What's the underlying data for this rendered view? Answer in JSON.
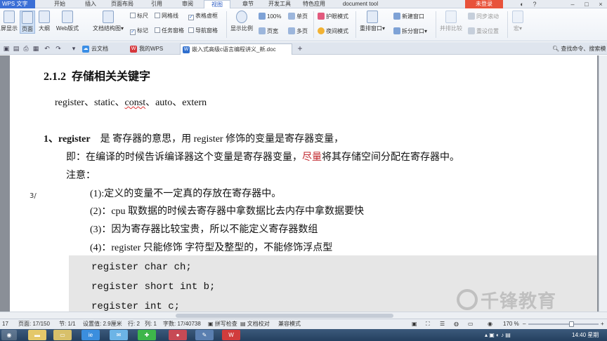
{
  "menubar": {
    "app": "WPS 文字",
    "items": [
      "开始",
      "插入",
      "页面布局",
      "引用",
      "审阅",
      "视图",
      "章节",
      "开发工具",
      "特色应用",
      "document tool"
    ],
    "active_index": 5,
    "login": "未登录"
  },
  "ribbon": {
    "view_buttons": [
      "屏显示",
      "页面",
      "大纲",
      "Web版式"
    ],
    "doc_structure": "文档结构图",
    "labels": "标记",
    "ruler": "标尺",
    "gridlines": "网格线",
    "table_gridlines": "表格虚框",
    "task_pane": "任务窗格",
    "nav_pane": "导航窗格",
    "zoom_label": "显示比例",
    "zoom_100": "100%",
    "page_width": "页宽",
    "single_page": "单页",
    "multi_page": "多页",
    "eye_mode": "护眼模式",
    "night_mode": "夜间模式",
    "arrange": "重排窗口",
    "new_window": "新建窗口",
    "split_window": "拆分窗口",
    "side_by_side": "并排比较",
    "sync_scroll": "同步滚动",
    "reset_pos": "重设位置",
    "macro": "宏"
  },
  "tabbar": {
    "tabs": [
      {
        "label": "云文档",
        "icon": "cloud-icon"
      },
      {
        "label": "我的WPS",
        "icon": "wps-icon"
      },
      {
        "label": "嵌入式高级c语言编程讲义_新.doc",
        "icon": "doc-icon"
      }
    ],
    "add_tab": "+",
    "search": "查找命令、搜索模"
  },
  "document": {
    "heading_num": "2.1.2",
    "heading_text": "存储相关关键字",
    "kw_prefix": "register、static、",
    "kw_const": "const",
    "kw_suffix": "、auto、extern",
    "item1_num": "1、register",
    "item1_text": "是  寄存器的意思，用 register 修饰的变量是寄存器变量，",
    "line2_a": "即：在编译的时候告诉编译器这个变量是寄存器变量，",
    "line2_red": "尽量",
    "line2_b": "将其存储空间分配在寄存器中。",
    "note": "注意：",
    "notes": [
      "(1):定义的变量不一定真的存放在寄存器中。",
      "(2)：cpu 取数据的时候去寄存器中拿数据比去内存中拿数据要快",
      "(3)：因为寄存器比较宝贵，所以不能定义寄存器数组",
      "(4)：register 只能修饰  字符型及整型的，不能修饰浮点型"
    ],
    "code": [
      "register char ch;",
      "register short int b;",
      "register int c;"
    ],
    "margin_mark": "3/",
    "watermark": "千锋教育"
  },
  "statusbar": {
    "line": "17",
    "page": "页面: 17/150",
    "section": "节: 1/1",
    "setting": "设置值: 2.9厘米",
    "row": "行: 2",
    "col": "列: 1",
    "words": "字数: 17/40738",
    "spell": "拼写检查",
    "doc_check": "文档校对",
    "compat": "兼容模式",
    "zoom": "170 %"
  },
  "taskbar": {
    "clock": "14:40 星期"
  }
}
